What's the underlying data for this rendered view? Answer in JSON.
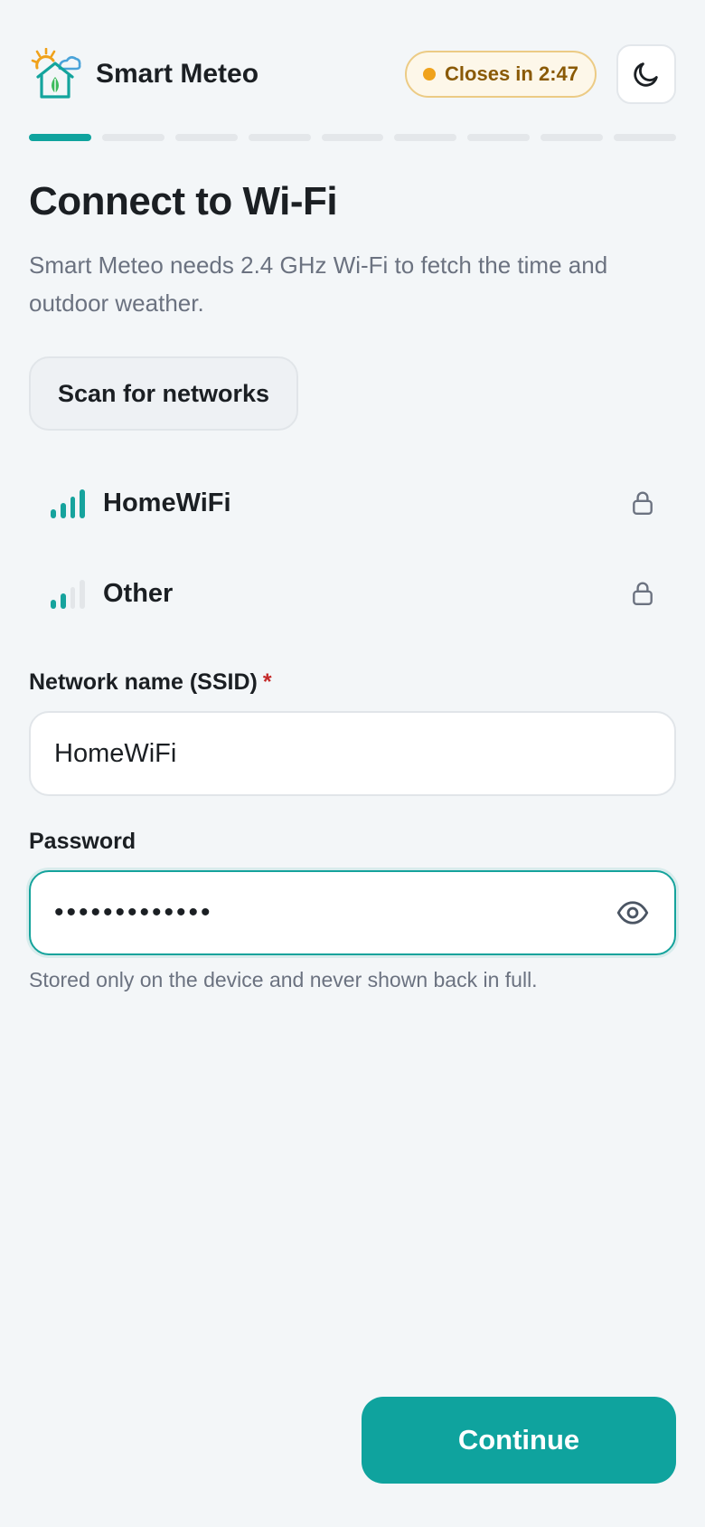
{
  "app": {
    "title": "Smart Meteo",
    "logo_icon": "smart-home-weather-logo",
    "timer_label": "Closes in 2:47",
    "theme_toggle_icon": "moon-icon"
  },
  "progress": {
    "total_steps": 9,
    "current_step": 1
  },
  "page": {
    "title": "Connect to Wi-Fi",
    "subtitle": "Smart Meteo needs 2.4 GHz Wi-Fi to fetch the time and outdoor weather."
  },
  "scan_button": {
    "label": "Scan for networks"
  },
  "networks": [
    {
      "name": "HomeWiFi",
      "signal_bars": 4,
      "locked": true
    },
    {
      "name": "Other",
      "signal_bars": 2,
      "locked": true
    }
  ],
  "ssid_field": {
    "label": "Network name (SSID)",
    "required_mark": "*",
    "value": "HomeWiFi"
  },
  "password_field": {
    "label": "Password",
    "masked_value": "•••••••••••••",
    "toggle_icon": "eye-icon"
  },
  "hint": "Stored only on the device and never shown back in full.",
  "continue_button": {
    "label": "Continue"
  },
  "colors": {
    "accent": "#0fa39e",
    "timer_border": "#eccb85",
    "timer_text": "#8a5a06",
    "timer_dot": "#f0a21b",
    "required": "#c42a2a"
  }
}
